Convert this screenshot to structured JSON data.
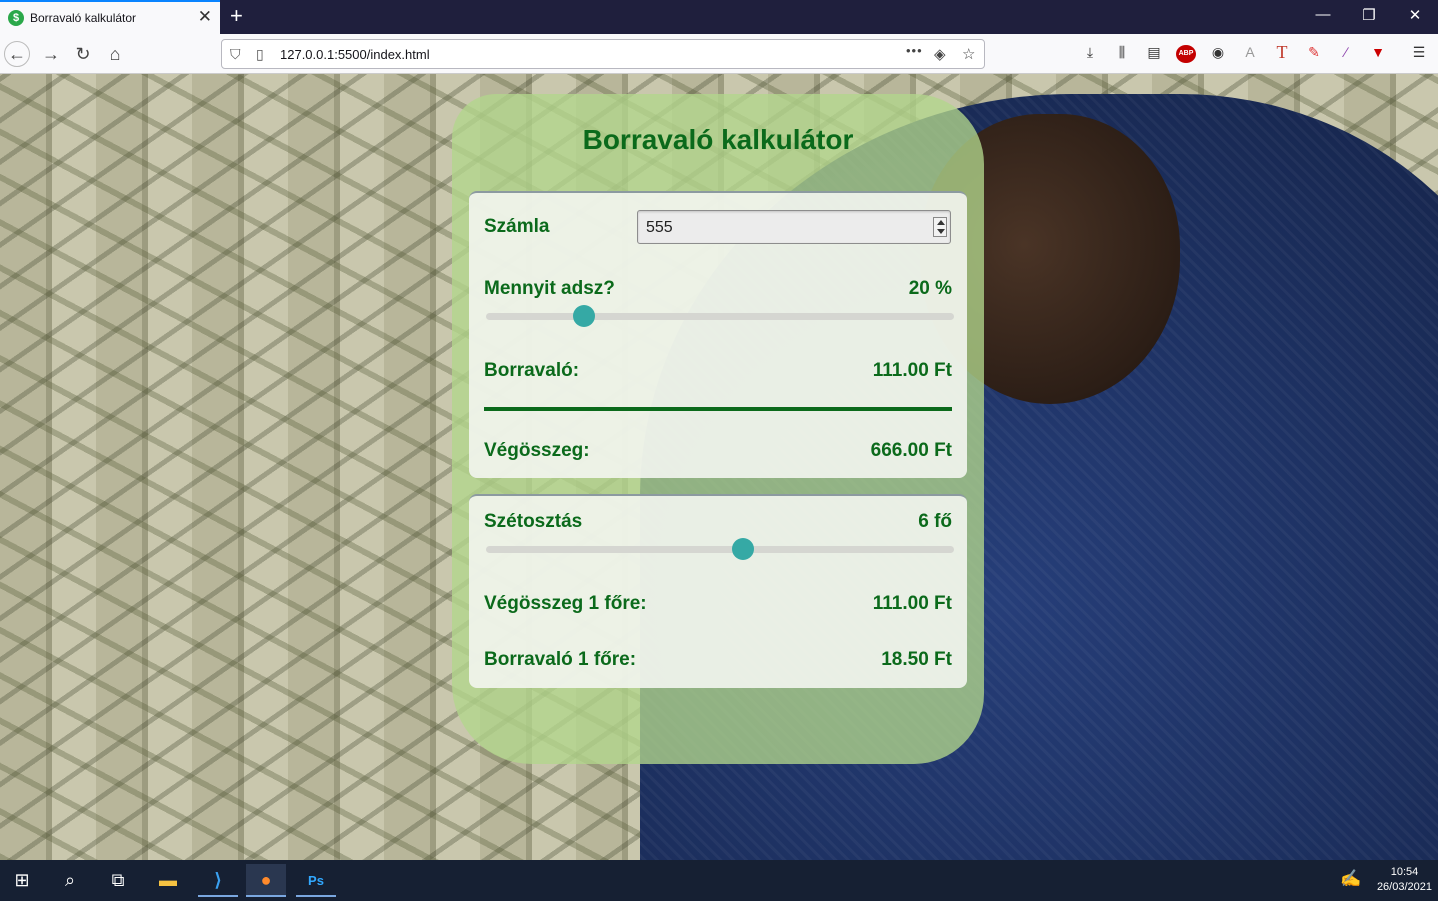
{
  "browser": {
    "tab_title": "Borravaló kalkulátor",
    "tab_favicon": "$",
    "new_tab": "+",
    "url": "127.0.0.1:5500/index.html",
    "window_controls": {
      "minimize": "—",
      "restore": "❐",
      "close": "✕"
    },
    "nav": {
      "back": "←",
      "forward": "→",
      "reload": "↻",
      "home": "⌂"
    },
    "url_actions": {
      "more": "•••",
      "pocket": "◈",
      "bookmark": "☆"
    },
    "toolbar": {
      "download": "⤓",
      "library": "⫼",
      "reader": "▤",
      "abp": "ABP",
      "account": "◉",
      "ext1": "A",
      "ext2": "T",
      "ext3": "✎",
      "ext4": "∕",
      "ext5": "▼",
      "menu": "☰"
    }
  },
  "app": {
    "title": "Borravaló kalkulátor",
    "bill_label": "Számla",
    "bill_value": "555",
    "tip_label": "Mennyit adsz?",
    "tip_percent_text": "20 %",
    "tip_percent": 20,
    "tip_slider_fraction": 0.21,
    "tip_amount_label": "Borravaló:",
    "tip_amount_value": "111.00 Ft",
    "total_label": "Végösszeg:",
    "total_value": "666.00 Ft",
    "split_label": "Szétosztás",
    "split_value_text": "6 fő",
    "split_people": 6,
    "split_slider_fraction": 0.55,
    "per_person_total_label": "Végösszeg 1 főre:",
    "per_person_total_value": "111.00 Ft",
    "per_person_tip_label": "Borravaló 1 főre:",
    "per_person_tip_value": "18.50 Ft"
  },
  "colors": {
    "accent_green": "#0b6a1b",
    "slider_thumb": "#35a9a5",
    "card_bg": "#b2d68c"
  },
  "taskbar": {
    "start": "⊞",
    "search": "⌕",
    "task_view": "⧉",
    "explorer": "▬",
    "vscode": "⟩",
    "firefox": "●",
    "photoshop": "Ps",
    "pen": "✍",
    "time": "10:54",
    "date": "26/03/2021"
  }
}
